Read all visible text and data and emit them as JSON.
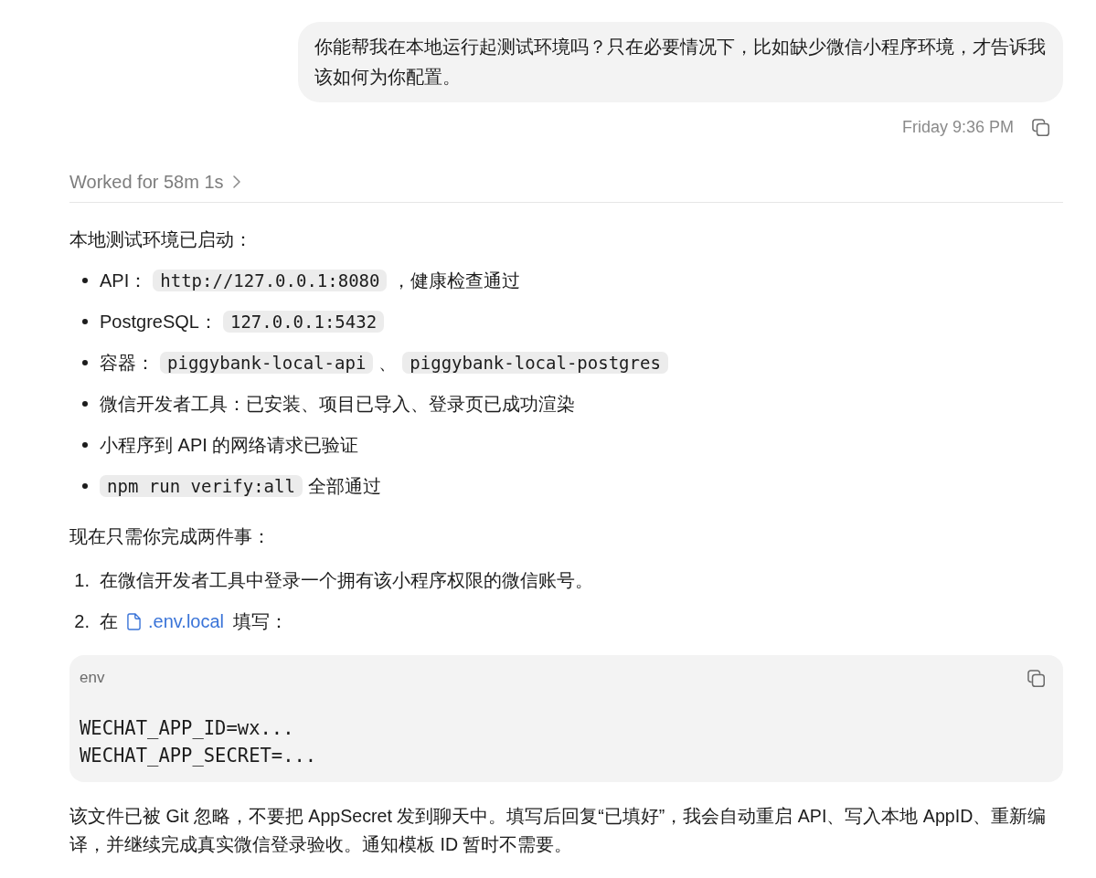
{
  "user_message": {
    "text": "你能帮我在本地运行起测试环境吗？只在必要情况下，比如缺少微信小程序环境，才告诉我该如何为你配置。",
    "time": "Friday 9:36 PM"
  },
  "work_summary": {
    "label": "Worked for 58m 1s",
    "expanded": false
  },
  "response": {
    "intro": "本地测试环境已启动：",
    "bullets": [
      [
        {
          "kind": "text",
          "text": "API："
        },
        {
          "kind": "code",
          "text": "http://127.0.0.1:8080"
        },
        {
          "kind": "text",
          "text": "，健康检查通过"
        }
      ],
      [
        {
          "kind": "text",
          "text": "PostgreSQL："
        },
        {
          "kind": "code",
          "text": "127.0.0.1:5432"
        }
      ],
      [
        {
          "kind": "text",
          "text": "容器："
        },
        {
          "kind": "code",
          "text": "piggybank-local-api"
        },
        {
          "kind": "text",
          "text": "、"
        },
        {
          "kind": "code",
          "text": "piggybank-local-postgres"
        }
      ],
      [
        {
          "kind": "text",
          "text": "微信开发者工具：已安装、项目已导入、登录页已成功渲染"
        }
      ],
      [
        {
          "kind": "text",
          "text": "小程序到 API 的网络请求已验证"
        }
      ],
      [
        {
          "kind": "code",
          "text": "npm run verify:all"
        },
        {
          "kind": "text",
          "text": "全部通过"
        }
      ]
    ],
    "tasks_intro": "现在只需你完成两件事：",
    "steps": [
      {
        "number": "1.",
        "segments": [
          {
            "kind": "text",
            "text": "在微信开发者工具中登录一个拥有该小程序权限的微信账号。"
          }
        ]
      },
      {
        "number": "2.",
        "segments": [
          {
            "kind": "text",
            "text": "在"
          },
          {
            "kind": "link",
            "text": ".env.local"
          },
          {
            "kind": "text",
            "text": "填写："
          }
        ]
      }
    ],
    "code_block": {
      "language": "env",
      "lines": [
        "WECHAT_APP_ID=wx...",
        "WECHAT_APP_SECRET=..."
      ]
    },
    "closing": "该文件已被 Git 忽略，不要把 AppSecret 发到聊天中。填写后回复“已填好”，我会自动重启 API、写入本地 AppID、重新编译，并继续完成真实微信登录验收。通知模板 ID 暂时不需要。"
  }
}
